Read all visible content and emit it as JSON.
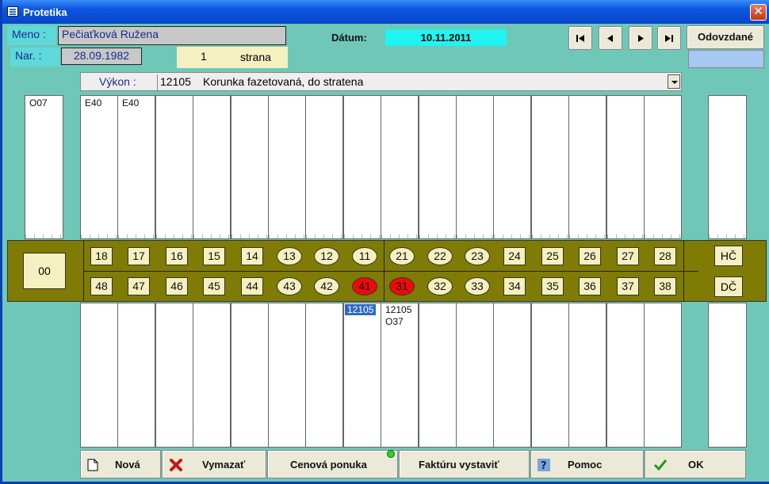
{
  "window": {
    "title": "Protetika",
    "close_glyph": "✕"
  },
  "patient": {
    "name_label": "Meno :",
    "name_value": "Pečiaťková Ružena",
    "birth_label": "Nar. :",
    "birth_value": "28.09.1982"
  },
  "page": {
    "number": "1",
    "label": "strana"
  },
  "date": {
    "label": "Dátum:",
    "value": "10.11.2011"
  },
  "toolbar": {
    "odovzdane_label": "Odovzdané"
  },
  "nav": [
    "first-record-icon",
    "prev-record-icon",
    "next-record-icon",
    "last-record-icon"
  ],
  "vykon": {
    "label": "Výkon :",
    "code": "12105",
    "description": "Korunka fazetovaná, do stratena"
  },
  "upper_side_code": "O07",
  "upper_codes": [
    "E40",
    "E40",
    "",
    "",
    "",
    "",
    "",
    "",
    "",
    "",
    "",
    "",
    "",
    "",
    "",
    ""
  ],
  "upper_teeth": [
    {
      "n": "18",
      "shape": "sq"
    },
    {
      "n": "17",
      "shape": "sq"
    },
    {
      "n": "16",
      "shape": "sq"
    },
    {
      "n": "15",
      "shape": "sq"
    },
    {
      "n": "14",
      "shape": "sq"
    },
    {
      "n": "13",
      "shape": "oval"
    },
    {
      "n": "12",
      "shape": "oval"
    },
    {
      "n": "11",
      "shape": "oval"
    },
    {
      "n": "21",
      "shape": "oval"
    },
    {
      "n": "22",
      "shape": "oval"
    },
    {
      "n": "23",
      "shape": "oval"
    },
    {
      "n": "24",
      "shape": "sq"
    },
    {
      "n": "25",
      "shape": "sq"
    },
    {
      "n": "26",
      "shape": "sq"
    },
    {
      "n": "27",
      "shape": "sq"
    },
    {
      "n": "28",
      "shape": "sq"
    }
  ],
  "lower_teeth": [
    {
      "n": "48",
      "shape": "sq"
    },
    {
      "n": "47",
      "shape": "sq"
    },
    {
      "n": "46",
      "shape": "sq"
    },
    {
      "n": "45",
      "shape": "sq"
    },
    {
      "n": "44",
      "shape": "sq"
    },
    {
      "n": "43",
      "shape": "oval"
    },
    {
      "n": "42",
      "shape": "oval"
    },
    {
      "n": "41",
      "shape": "oval",
      "marked": true
    },
    {
      "n": "31",
      "shape": "oval",
      "marked": true
    },
    {
      "n": "32",
      "shape": "oval"
    },
    {
      "n": "33",
      "shape": "oval"
    },
    {
      "n": "34",
      "shape": "sq"
    },
    {
      "n": "35",
      "shape": "sq"
    },
    {
      "n": "36",
      "shape": "sq"
    },
    {
      "n": "37",
      "shape": "sq"
    },
    {
      "n": "38",
      "shape": "sq"
    }
  ],
  "zero_box": "00",
  "upper_jaw_btn": "HČ",
  "lower_jaw_btn": "DČ",
  "lower_codes": {
    "col8_selected": "12105",
    "col9_line1": "12105",
    "col9_line2": "O37"
  },
  "buttons": {
    "nova": "Nová",
    "vymazat": "Vymazať",
    "cenova": "Cenová ponuka",
    "fakturu": "Faktúru vystaviť",
    "pomoc": "Pomoc",
    "ok": "OK"
  },
  "colors": {
    "background": "#6fc7b7",
    "band": "#7f7b05",
    "tooth": "#f4f0c0",
    "marked": "#ee0a0a",
    "label_bg": "#5fd8da",
    "date_bg": "#1ff4f2"
  }
}
